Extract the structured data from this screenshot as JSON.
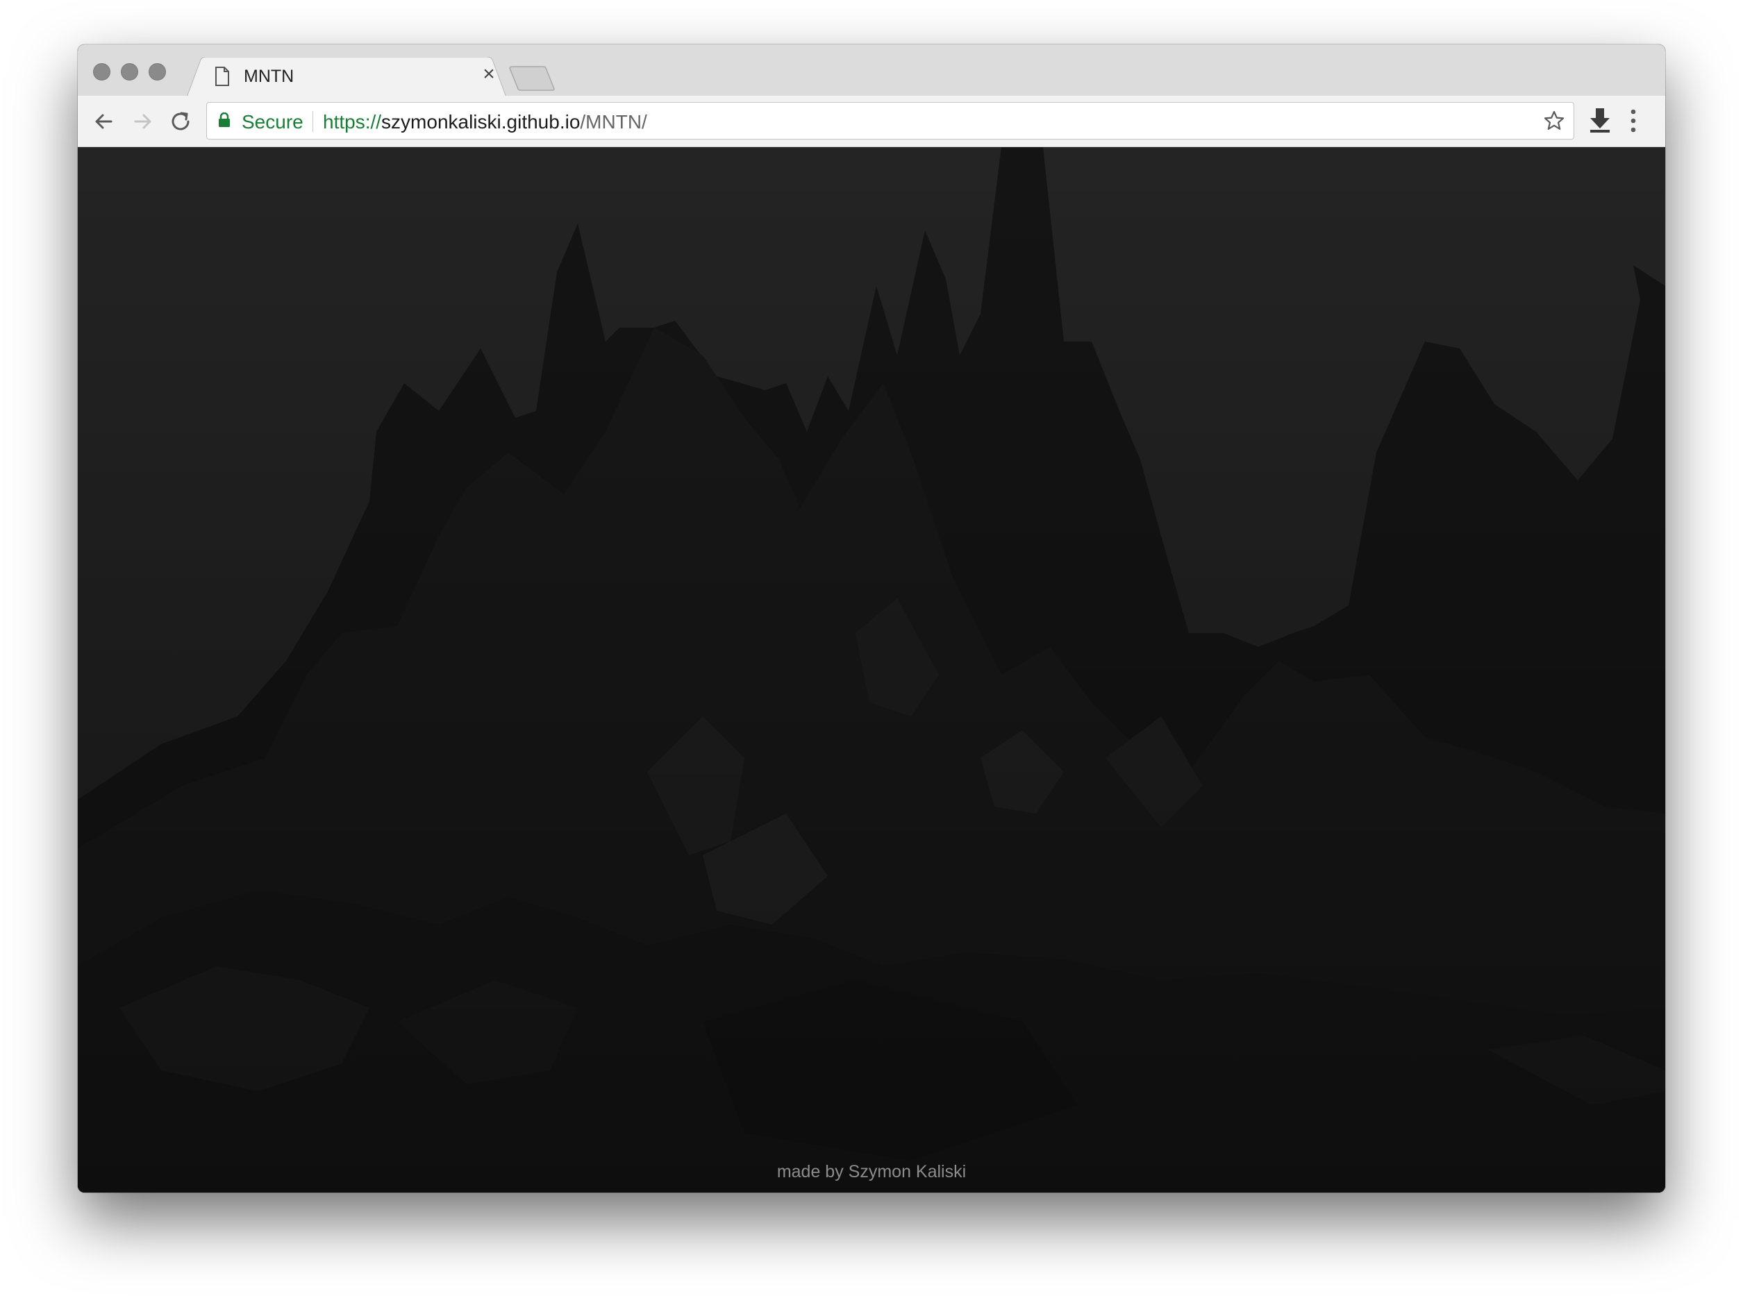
{
  "browser": {
    "tab": {
      "title": "MNTN",
      "close_label": "×"
    },
    "address_bar": {
      "security_label": "Secure",
      "url_scheme": "https://",
      "url_host": "szymonkaliski.github.io",
      "url_path": "/MNTN/"
    },
    "icons": {
      "back": "arrow-left-icon",
      "forward": "arrow-right-icon",
      "reload": "reload-icon",
      "lock": "lock-icon",
      "bookmark": "star-icon",
      "download": "download-icon",
      "menu": "kebab-menu-icon",
      "tab_favicon": "document-icon"
    },
    "colors": {
      "secure_green": "#1a7e36",
      "page_background": "#202020"
    }
  },
  "page": {
    "credit": "made by Szymon Kaliski"
  }
}
